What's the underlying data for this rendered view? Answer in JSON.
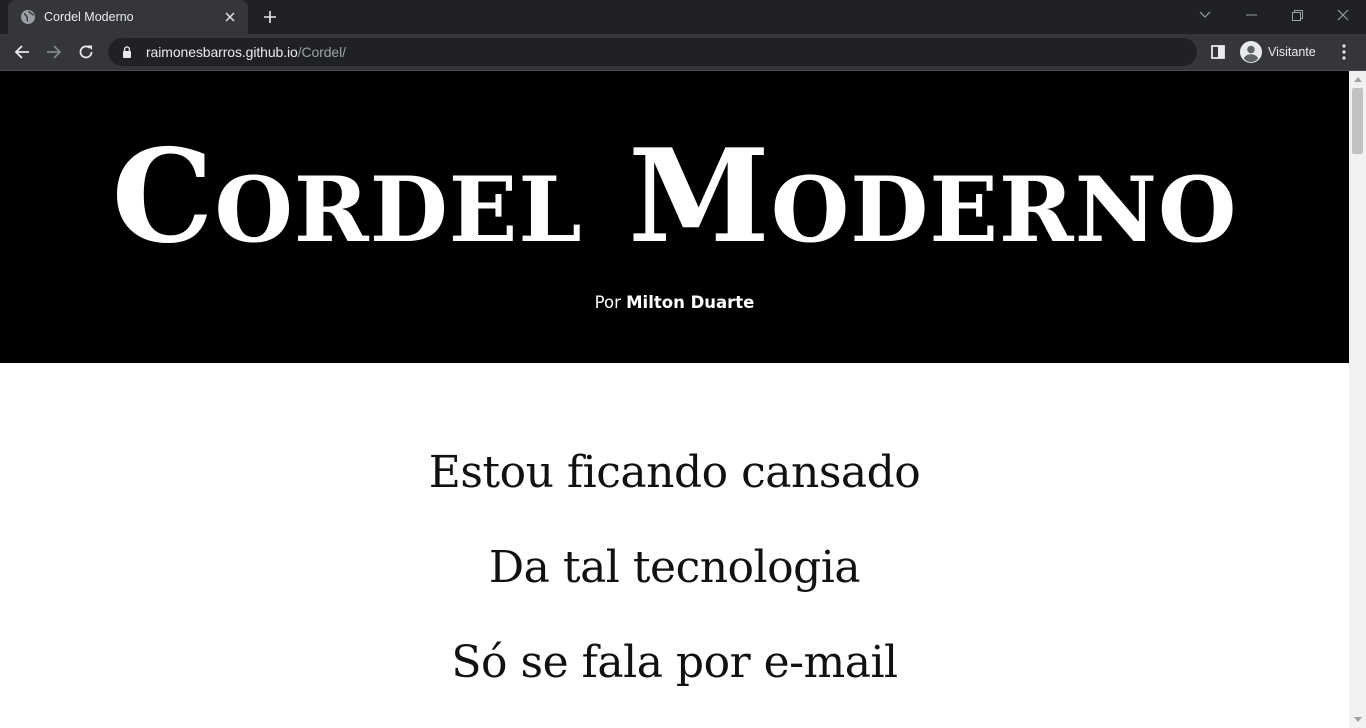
{
  "browser": {
    "tab": {
      "title": "Cordel Moderno"
    },
    "address": {
      "host": "raimonesbarros.github.io",
      "path": "/Cordel/"
    },
    "profile": {
      "label": "Visitante"
    },
    "icons": [
      "globe-icon",
      "close-icon",
      "plus-icon",
      "chevron-down-icon",
      "minimize-icon",
      "restore-icon",
      "window-close-icon",
      "back-icon",
      "forward-icon",
      "reload-icon",
      "lock-icon",
      "side-panel-icon",
      "avatar-icon",
      "kebab-menu-icon"
    ],
    "colors": {
      "tabbar": "#202124",
      "toolbar": "#35363a",
      "omnibox": "#202124",
      "text": "#e8eaed"
    }
  },
  "page": {
    "hero": {
      "title": "Cordel Moderno",
      "byline_prefix": "Por",
      "byline_author": "Milton Duarte",
      "background": "#000000"
    },
    "verses": [
      "Estou ficando cansado",
      "Da tal tecnologia",
      "Só se fala por e-mail"
    ]
  }
}
